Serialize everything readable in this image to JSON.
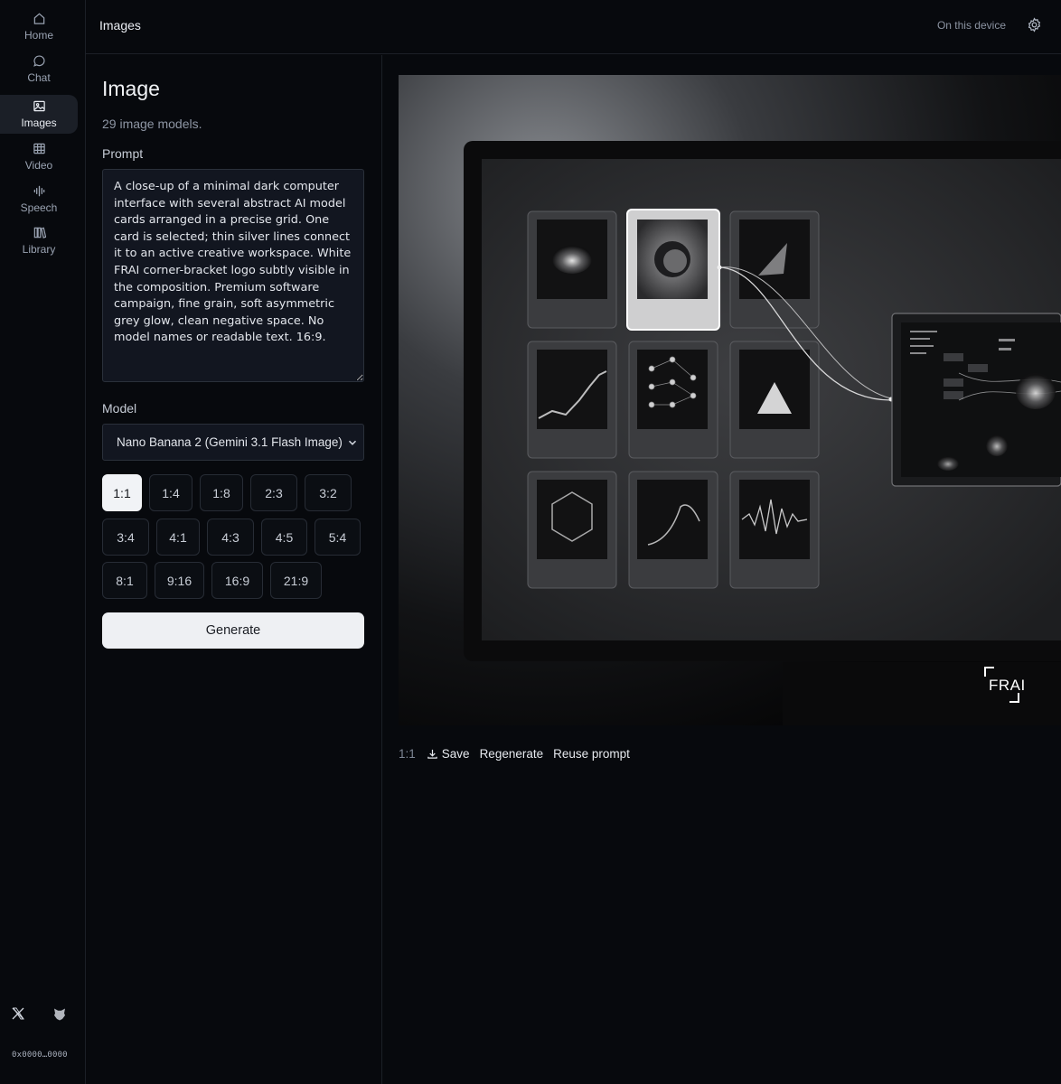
{
  "nav": {
    "items": [
      {
        "label": "Home",
        "icon": "home-icon"
      },
      {
        "label": "Chat",
        "icon": "chat-icon"
      },
      {
        "label": "Images",
        "icon": "image-icon",
        "active": true
      },
      {
        "label": "Video",
        "icon": "film-icon"
      },
      {
        "label": "Speech",
        "icon": "waveform-icon"
      },
      {
        "label": "Library",
        "icon": "books-icon"
      }
    ],
    "footer_icons": [
      "x-logo-icon",
      "fox-logo-icon"
    ],
    "wallet": "0x0000…0000"
  },
  "header": {
    "title": "Images",
    "storage": "On this device",
    "settings_icon": "gear-icon"
  },
  "panel": {
    "title": "Image",
    "model_count": "29 image models.",
    "prompt_label": "Prompt",
    "prompt_value": "A close-up of a minimal dark computer interface with several abstract AI model cards arranged in a precise grid. One card is selected; thin silver lines connect it to an active creative workspace. White FRAI corner-bracket logo subtly visible in the composition. Premium software campaign, fine grain, soft asymmetric grey glow, clean negative space. No model names or readable text. 16:9.",
    "model_label": "Model",
    "model_value": "Nano Banana 2 (Gemini 3.1 Flash Image)",
    "ratios": [
      "1:1",
      "1:4",
      "1:8",
      "2:3",
      "3:2",
      "3:4",
      "4:1",
      "4:3",
      "4:5",
      "5:4",
      "8:1",
      "9:16",
      "16:9",
      "21:9"
    ],
    "selected_ratio": "1:1",
    "generate_label": "Generate"
  },
  "result": {
    "watermark": "FRAI",
    "aspect": "1:1",
    "save_label": "Save",
    "regenerate_label": "Regenerate",
    "reuse_label": "Reuse prompt"
  },
  "colors": {
    "background": "#07090d",
    "surface": "#121620",
    "border": "#2a303a",
    "selected_ratio_bg": "#f1f3f6",
    "generate_bg": "#eef0f3"
  }
}
